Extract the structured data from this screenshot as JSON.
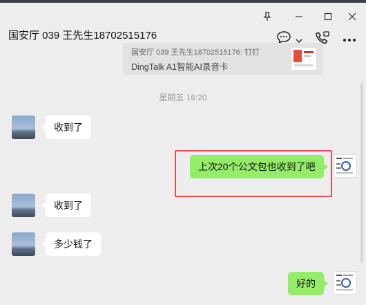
{
  "window": {
    "pin_icon": "pin-icon",
    "minimize_icon": "minimize-icon",
    "maximize_icon": "maximize-icon",
    "close_icon": "close-icon"
  },
  "header": {
    "title": "国安厅 039 王先生18702515176",
    "icons": [
      "chat-bubble-icon",
      "chevron-down-icon",
      "phone-icon",
      "more-icon"
    ]
  },
  "quote": {
    "line1": "国安厅 039 王先生18702515176: 钉钉",
    "line2": "DingTalk A1智能AI录音卡"
  },
  "timestamp": "星期五 16:20",
  "messages": [
    {
      "side": "left",
      "text": "收到了"
    },
    {
      "side": "right",
      "text": "上次20个公文包也收到了吧"
    },
    {
      "side": "left",
      "text": "收到了"
    },
    {
      "side": "left",
      "text": "多少钱了"
    },
    {
      "side": "right",
      "text": "好的"
    }
  ],
  "colors": {
    "background": "#ededed",
    "bubble_right": "#95ec69",
    "bubble_left": "#ffffff",
    "highlight": "#e6484f"
  }
}
